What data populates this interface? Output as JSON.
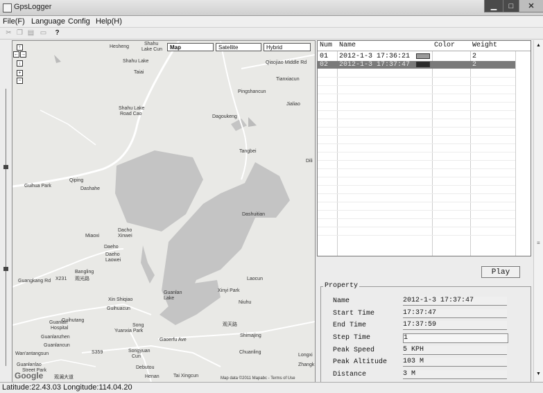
{
  "window": {
    "title": "GpsLogger"
  },
  "menu": {
    "items": [
      "File(F)",
      "Language",
      "Config",
      "Help(H)"
    ]
  },
  "toolbar": {
    "icons": [
      "cut-icon",
      "copy-icon",
      "paste-icon",
      "print-icon",
      "help-icon"
    ]
  },
  "map": {
    "tabs": [
      "Map",
      "Satellite",
      "Hybrid"
    ],
    "selected_tab": "Map",
    "labels": [
      "Hesheng",
      "Shahu",
      "Lake Cun",
      "Shahu Lake",
      "Taiai",
      "Qiaojiao Middle Rd",
      "Tianxiacun",
      "Pingshancun",
      "Jialiao",
      "Shahu Lake",
      "Road Cao",
      "Dagoukeng",
      "Tangbei",
      "Dili",
      "Qiping",
      "Guihua Park",
      "Dashahe",
      "Dashuitian",
      "Dacho",
      "Xinwei",
      "Miaoxi",
      "Daeho",
      "Daeho",
      "Laowei",
      "Bangling",
      "Guangkang Rd",
      "X231",
      "观光路",
      "Laocun",
      "Xin Shiqiao",
      "Guanlan",
      "Lake",
      "Xinyi Park",
      "Niuhu",
      "Guihuacun",
      "Guihutang",
      "Guanlan",
      "Hospital",
      "Song",
      "Yuanxia Park",
      "Guanlanzhen",
      "Gaoerfu Ave",
      "Shimajing",
      "观天路",
      "Guanlancun",
      "S359",
      "Wan'antangsun",
      "Songyuan",
      "Cun",
      "Chuanling",
      "Longxi",
      "Zhangk",
      "Guanlanlao",
      "Street Park",
      "Debutou",
      "Henan",
      "Tai Xingcun",
      "观澜大道"
    ],
    "credit": "Map data ©2011 Mapabc - Terms of Use",
    "logo": "Google"
  },
  "track_table": {
    "columns": [
      "Num",
      "Name",
      "Color",
      "Weight"
    ],
    "rows": [
      {
        "num": "01",
        "name": "2012-1-3 17:36:21",
        "color": "#9a9a9a",
        "weight": "2",
        "selected": false
      },
      {
        "num": "02",
        "name": "2012-1-3 17:37:47",
        "color": "#2b2b2b",
        "weight": "2",
        "selected": true
      }
    ]
  },
  "play_button": "Play",
  "property": {
    "legend": "Property",
    "fields": [
      {
        "label": "Name",
        "value": "2012-1-3 17:37:47"
      },
      {
        "label": "Start Time",
        "value": "17:37:47"
      },
      {
        "label": "End Time",
        "value": "17:37:59"
      },
      {
        "label": "Step Time",
        "value": "1"
      },
      {
        "label": "Peak Speed",
        "value": "5 KPH"
      },
      {
        "label": "Peak Altitude",
        "value": "103 M"
      },
      {
        "label": "Distance",
        "value": "3 M"
      }
    ]
  },
  "status": {
    "text": "Latitude:22.43.03 Longitude:114.04.20"
  }
}
